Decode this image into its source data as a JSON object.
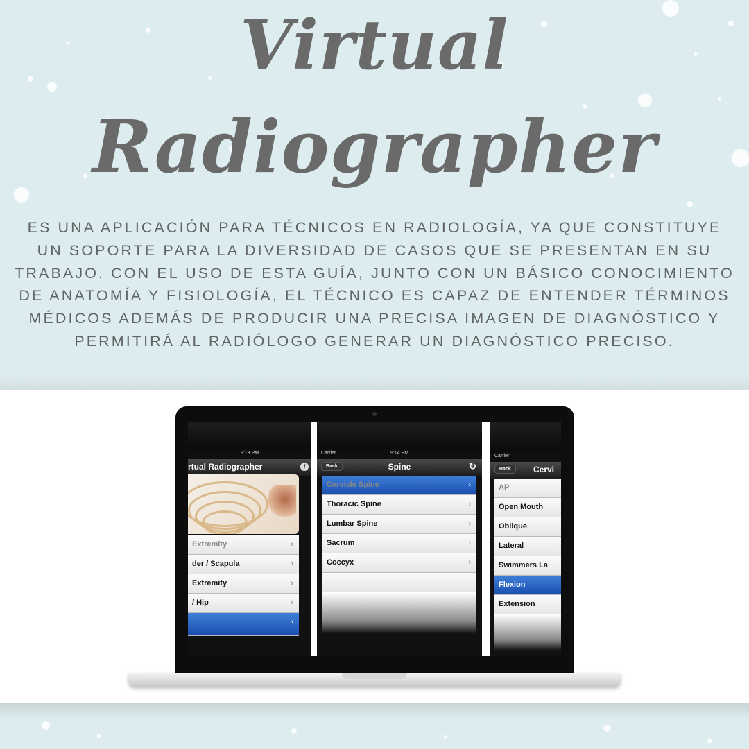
{
  "title": {
    "line1": "Virtual",
    "line2": "Radiographer"
  },
  "description": "ES UNA APLICACIÓN  PARA TÉCNICOS EN RADIOLOGÍA, YA QUE CONSTITUYE UN SOPORTE PARA LA DIVERSIDAD DE CASOS QUE SE PRESENTAN EN SU TRABAJO. CON EL USO DE ESTA GUÍA, JUNTO CON UN BÁSICO CONOCIMIENTO DE ANATOMÍA Y FISIOLOGÍA, EL TÉCNICO ES CAPAZ DE ENTENDER TÉRMINOS MÉDICOS ADEMÁS DE PRODUCIR UNA PRECISA IMAGEN DE DIAGNÓSTICO Y PERMITIRÁ AL RADIÓLOGO GENERAR UN DIAGNÓSTICO PRECISO.",
  "colors": {
    "background": "#ddecee",
    "title": "#6a6a6a",
    "text": "#5f6466",
    "selection": "#2a63c4"
  },
  "phone1": {
    "time": "9:13 PM",
    "nav_title": "rtual Radiographer",
    "info_icon": "i",
    "items": [
      {
        "label": "Extremity",
        "chevron": "›"
      },
      {
        "label": "der / Scapula",
        "chevron": "›"
      },
      {
        "label": "Extremity",
        "chevron": "›"
      },
      {
        "label": "/ Hip",
        "chevron": "›"
      },
      {
        "label": "",
        "chevron": "›"
      }
    ]
  },
  "phone2": {
    "carrier": "Carrier",
    "time": "9:14 PM",
    "back_label": "Back",
    "nav_title": "Spine",
    "refresh_icon": "↻",
    "items": [
      {
        "label": "Cervicle Spine",
        "chevron": "›"
      },
      {
        "label": "Thoracic Spine",
        "chevron": "›"
      },
      {
        "label": "Lumbar Spine",
        "chevron": "›"
      },
      {
        "label": "Sacrum",
        "chevron": "›"
      },
      {
        "label": "Coccyx",
        "chevron": "›"
      }
    ]
  },
  "phone3": {
    "carrier": "Carrier",
    "back_label": "Back",
    "nav_title": "Cervi",
    "items": [
      {
        "label": "AP"
      },
      {
        "label": "Open Mouth"
      },
      {
        "label": "Oblique"
      },
      {
        "label": "Lateral"
      },
      {
        "label": "Swimmers La"
      },
      {
        "label": "Flexion"
      },
      {
        "label": "Extension"
      }
    ]
  }
}
